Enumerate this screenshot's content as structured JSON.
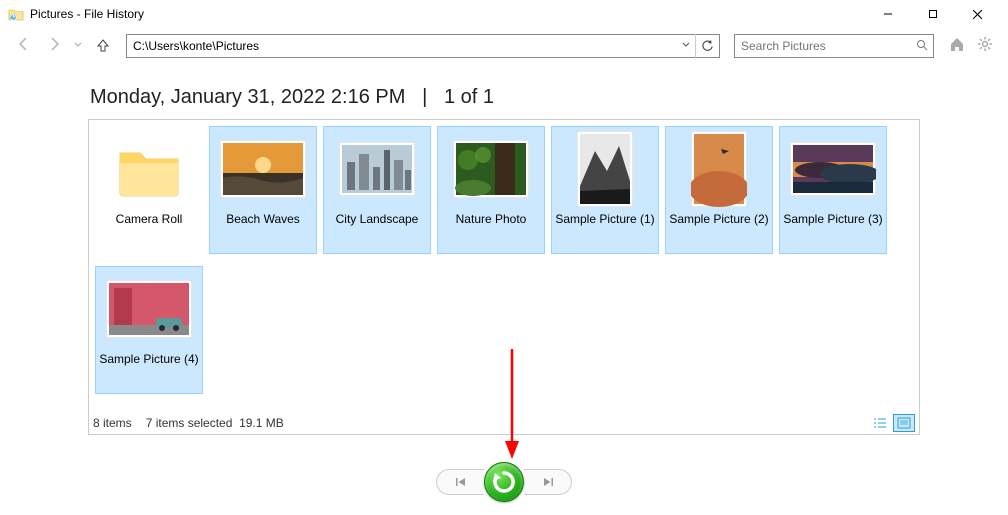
{
  "window": {
    "title": "Pictures - File History"
  },
  "toolbar": {
    "path": "C:\\Users\\konte\\Pictures",
    "search_placeholder": "Search Pictures"
  },
  "heading": {
    "datetime": "Monday, January 31, 2022 2:16 PM",
    "divider": "|",
    "page": "1 of 1"
  },
  "items": [
    {
      "label": "Camera Roll",
      "type": "folder",
      "selected": false
    },
    {
      "label": "Beach Waves",
      "type": "image",
      "selected": true
    },
    {
      "label": "City Landscape",
      "type": "image",
      "selected": true
    },
    {
      "label": "Nature Photo",
      "type": "image",
      "selected": true
    },
    {
      "label": "Sample Picture (1)",
      "type": "image",
      "selected": true
    },
    {
      "label": "Sample Picture (2)",
      "type": "image",
      "selected": true
    },
    {
      "label": "Sample Picture (3)",
      "type": "image",
      "selected": true
    },
    {
      "label": "Sample Picture (4)",
      "type": "image",
      "selected": true
    }
  ],
  "status": {
    "count": "8 items",
    "selection": "7 items selected",
    "size": "19.1 MB"
  },
  "controls": {
    "prev": "Previous version",
    "restore": "Restore",
    "next": "Next version"
  }
}
